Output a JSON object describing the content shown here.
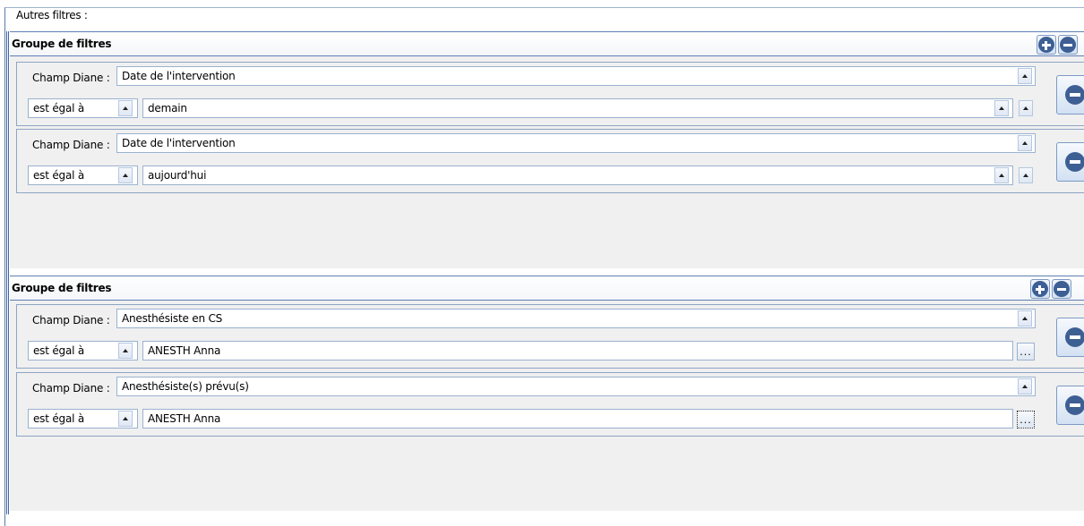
{
  "legend": "Autres filtres :",
  "groups": [
    {
      "title": "Groupe de filtres",
      "filters": [
        {
          "field_label": "Champ Diane :",
          "field_value": "Date de l'intervention",
          "operator": "est égal à",
          "value": "demain",
          "value_control": "dropdown"
        },
        {
          "field_label": "Champ Diane :",
          "field_value": "Date de l'intervention",
          "operator": "est égal à",
          "value": "aujourd'hui",
          "value_control": "dropdown"
        }
      ]
    },
    {
      "title": "Groupe de filtres",
      "filters": [
        {
          "field_label": "Champ Diane :",
          "field_value": "Anesthésiste en CS",
          "operator": "est égal à",
          "value": "ANESTH Anna",
          "value_control": "browse",
          "browse_label": "..."
        },
        {
          "field_label": "Champ Diane :",
          "field_value": "Anesthésiste(s) prévu(s)",
          "operator": "est égal à",
          "value": "ANESTH Anna",
          "value_control": "browse",
          "browse_label": "..."
        }
      ]
    }
  ],
  "icons": {
    "add": "plus-circle-icon",
    "remove": "minus-circle-icon",
    "dropdown": "triangle-up-icon"
  },
  "colors": {
    "icon_blue": "#3d5f94",
    "border_blue": "#5f7fb3",
    "panel_bg": "#f0f0f0"
  }
}
